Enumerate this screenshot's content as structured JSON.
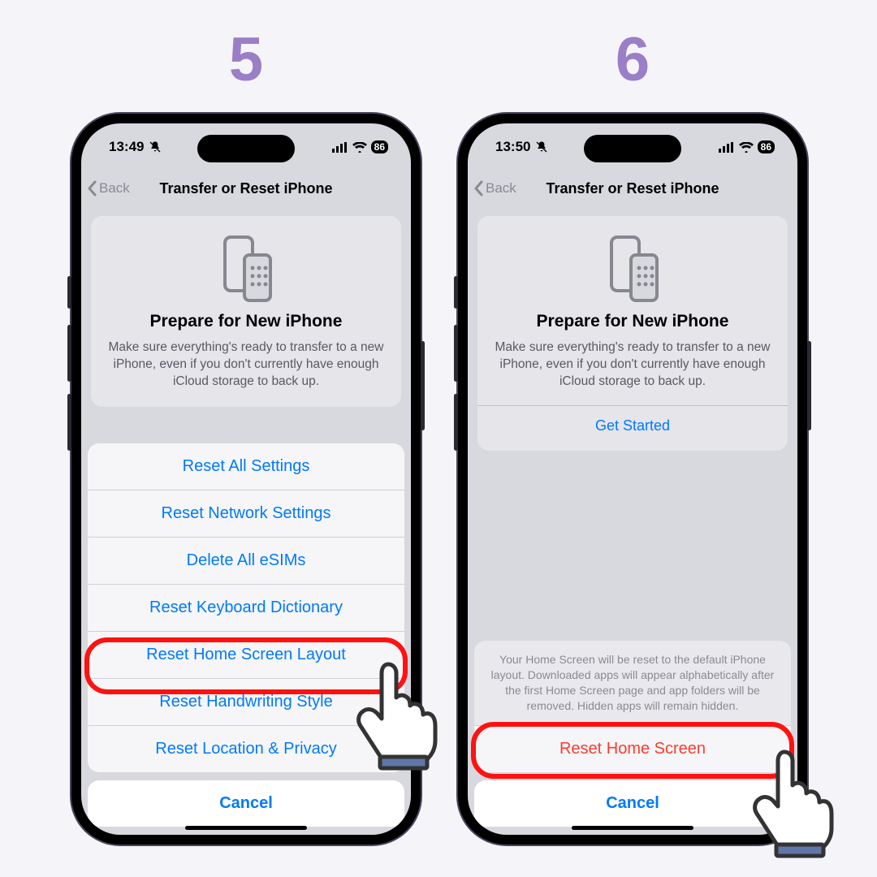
{
  "steps": {
    "left": "5",
    "right": "6"
  },
  "status_left": {
    "time": "13:49",
    "battery": "86"
  },
  "status_right": {
    "time": "13:50",
    "battery": "86"
  },
  "nav": {
    "back": "Back",
    "title": "Transfer or Reset iPhone"
  },
  "card": {
    "heading": "Prepare for New iPhone",
    "body": "Make sure everything's ready to transfer to a new iPhone, even if you don't currently have enough iCloud storage to back up.",
    "get_started": "Get Started"
  },
  "sheet_left": {
    "items": [
      "Reset All Settings",
      "Reset Network Settings",
      "Delete All eSIMs",
      "Reset Keyboard Dictionary",
      "Reset Home Screen Layout",
      "Reset Handwriting Style",
      "Reset Location & Privacy"
    ],
    "cancel": "Cancel"
  },
  "sheet_right": {
    "message": "Your Home Screen will be reset to the default iPhone layout. Downloaded apps will appear alphabetically after the first Home Screen page and app folders will be removed. Hidden apps will remain hidden.",
    "action": "Reset Home Screen",
    "cancel": "Cancel"
  }
}
